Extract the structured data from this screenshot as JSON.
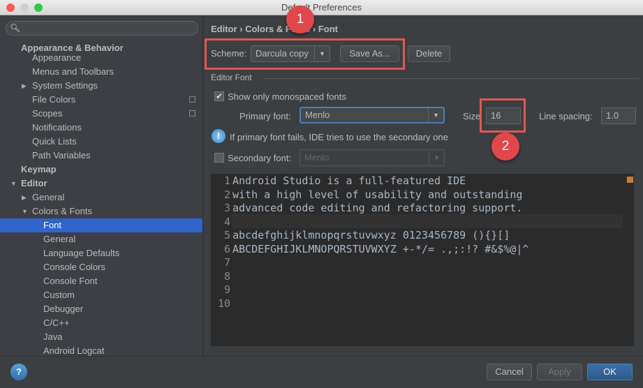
{
  "window": {
    "title": "Default Preferences"
  },
  "sidebar": {
    "search_placeholder": "",
    "items": [
      {
        "label": "Appearance & Behavior",
        "level": 0,
        "bold": true
      },
      {
        "label": "Appearance",
        "level": 1
      },
      {
        "label": "Menus and Toolbars",
        "level": 1
      },
      {
        "label": "System Settings",
        "level": 1,
        "arrow": "right"
      },
      {
        "label": "File Colors",
        "level": 1,
        "copy": true
      },
      {
        "label": "Scopes",
        "level": 1,
        "copy": true
      },
      {
        "label": "Notifications",
        "level": 1
      },
      {
        "label": "Quick Lists",
        "level": 1
      },
      {
        "label": "Path Variables",
        "level": 1
      },
      {
        "label": "Keymap",
        "level": 0,
        "bold": true
      },
      {
        "label": "Editor",
        "level": 0,
        "bold": true,
        "arrow": "down"
      },
      {
        "label": "General",
        "level": 1,
        "arrow": "right"
      },
      {
        "label": "Colors & Fonts",
        "level": 1,
        "arrow": "down"
      },
      {
        "label": "Font",
        "level": 2,
        "selected": true
      },
      {
        "label": "General",
        "level": 2
      },
      {
        "label": "Language Defaults",
        "level": 2
      },
      {
        "label": "Console Colors",
        "level": 2
      },
      {
        "label": "Console Font",
        "level": 2
      },
      {
        "label": "Custom",
        "level": 2
      },
      {
        "label": "Debugger",
        "level": 2
      },
      {
        "label": "C/C++",
        "level": 2
      },
      {
        "label": "Java",
        "level": 2
      },
      {
        "label": "Android Logcat",
        "level": 2
      }
    ]
  },
  "breadcrumb": "Editor › Colors & Fonts › Font",
  "scheme": {
    "label": "Scheme:",
    "value": "Darcula copy",
    "save_as": "Save As...",
    "delete": "Delete"
  },
  "editor_font": {
    "section": "Editor Font",
    "mono_label": "Show only monospaced fonts",
    "mono_checked": true,
    "primary_label": "Primary font:",
    "primary_value": "Menlo",
    "size_label": "Size",
    "size_value": "16",
    "line_spacing_label": "Line spacing:",
    "line_spacing_value": "1.0",
    "info": "If primary font fails, IDE tries to use the secondary one",
    "secondary_label": "Secondary font:",
    "secondary_value": "Menlo",
    "secondary_checked": false
  },
  "preview": {
    "lines": [
      "Android Studio is a full-featured IDE",
      "with a high level of usability and outstanding",
      "advanced code editing and refactoring support.",
      "",
      "abcdefghijklmnopqrstuvwxyz 0123456789 (){}[]",
      "ABCDEFGHIJKLMNOPQRSTUVWXYZ +-*/= .,;:!? #&$%@|^",
      "",
      "",
      "",
      ""
    ],
    "line_numbers": [
      "1",
      "2",
      "3",
      "4",
      "5",
      "6",
      "7",
      "8",
      "9",
      "10"
    ]
  },
  "annotations": [
    "1",
    "2"
  ],
  "footer": {
    "help": "?",
    "cancel": "Cancel",
    "apply": "Apply",
    "ok": "OK"
  },
  "colors": {
    "accent": "#2f65ca",
    "annotation": "#e0474a"
  }
}
